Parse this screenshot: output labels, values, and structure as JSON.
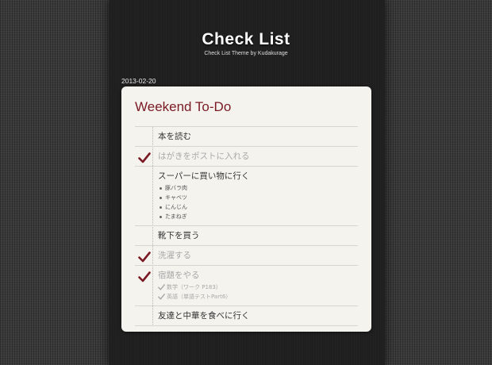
{
  "header": {
    "title": "Check List",
    "subtitle": "Check List Theme by Kudakurage"
  },
  "post": {
    "date": "2013-02-20",
    "title": "Weekend To-Do",
    "items": [
      {
        "label": "本を読む",
        "checked": false
      },
      {
        "label": "はがきをポストに入れる",
        "checked": true
      },
      {
        "label": "スーパーに買い物に行く",
        "checked": false,
        "subitems": [
          "豚バラ肉",
          "キャベツ",
          "にんじん",
          "たまねぎ"
        ]
      },
      {
        "label": "靴下を買う",
        "checked": false
      },
      {
        "label": "洗濯する",
        "checked": true
      },
      {
        "label": "宿題をやる",
        "checked": true,
        "subitems": [
          "数学（ワーク P183）",
          "英語（単語テストPart6）"
        ]
      },
      {
        "label": "友達と中華を食べに行く",
        "checked": false
      }
    ]
  },
  "colors": {
    "accent": "#7a1a24",
    "check": "#7a1a24"
  },
  "icons": {
    "check": "check-mark-icon",
    "bullet": "bullet-icon"
  }
}
